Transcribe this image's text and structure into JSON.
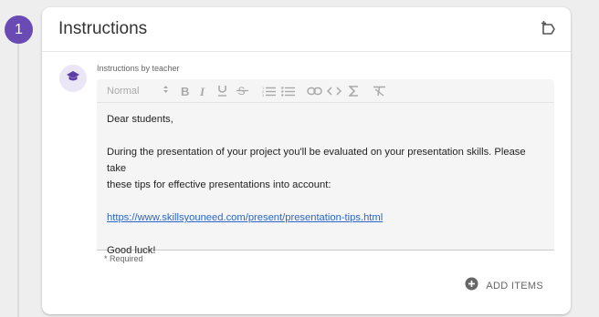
{
  "step": {
    "number": "1"
  },
  "card": {
    "title": "Instructions",
    "teacher_label": "Instructions by teacher",
    "required_note": "* Required",
    "add_items_label": "ADD ITEMS"
  },
  "toolbar": {
    "format_value": "Normal",
    "buttons": [
      "bold-icon",
      "italic-icon",
      "underline-icon",
      "strikethrough-icon",
      "numbered-list-icon",
      "bulleted-list-icon",
      "link-icon",
      "code-icon",
      "sigma-icon",
      "clear-format-icon"
    ]
  },
  "editor": {
    "greeting": "Dear students,",
    "paragraph_line1": "During the presentation of your project you'll be evaluated on your presentation skills. Please take",
    "paragraph_line2": "these tips for effective presentations into account:",
    "link": "https://www.skillsyouneed.com/present/presentation-tips.html",
    "closing": "Good luck!"
  },
  "colors": {
    "accent": "#6a4bb4",
    "link": "#2a66c9",
    "background": "#eeeeee"
  }
}
